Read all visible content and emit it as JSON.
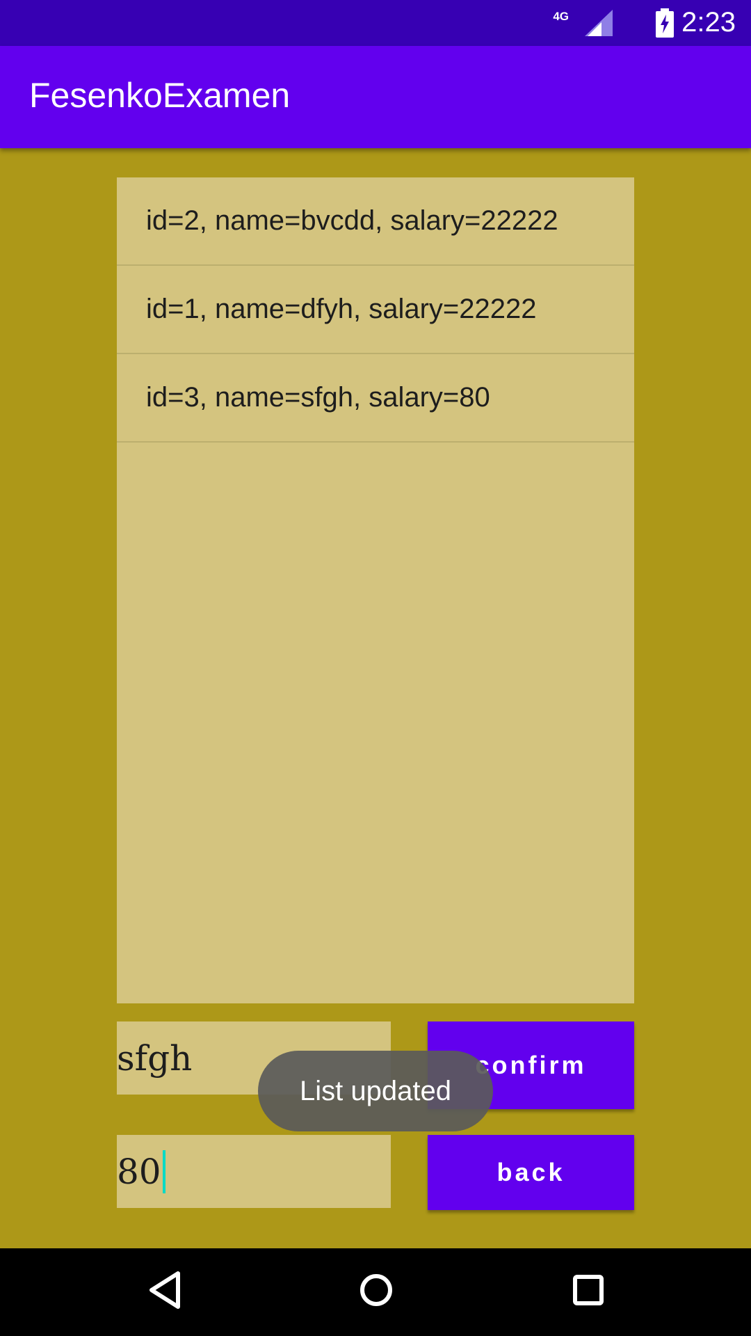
{
  "status_bar": {
    "network_type": "4G",
    "time": "2:23",
    "icons": [
      "signal-icon",
      "battery-charging-icon"
    ]
  },
  "app_bar": {
    "title": "FesenkoExamen"
  },
  "list": {
    "items": [
      "id=2, name=bvcdd, salary=22222",
      "id=1, name=dfyh, salary=22222",
      "id=3, name=sfgh, salary=80"
    ]
  },
  "form": {
    "name_value": "sfgh",
    "salary_value": "80",
    "confirm_label": "confirm",
    "back_label": "back"
  },
  "toast": {
    "message": "List updated"
  },
  "nav_bar": {
    "icons": [
      "back-triangle-icon",
      "home-circle-icon",
      "recents-square-icon"
    ]
  },
  "colors": {
    "status_bar": "#3700b3",
    "app_bar": "#6200ee",
    "background": "#ad9818",
    "panel": "#d4c47f",
    "button": "#6200ee",
    "cursor": "#03dac5"
  }
}
